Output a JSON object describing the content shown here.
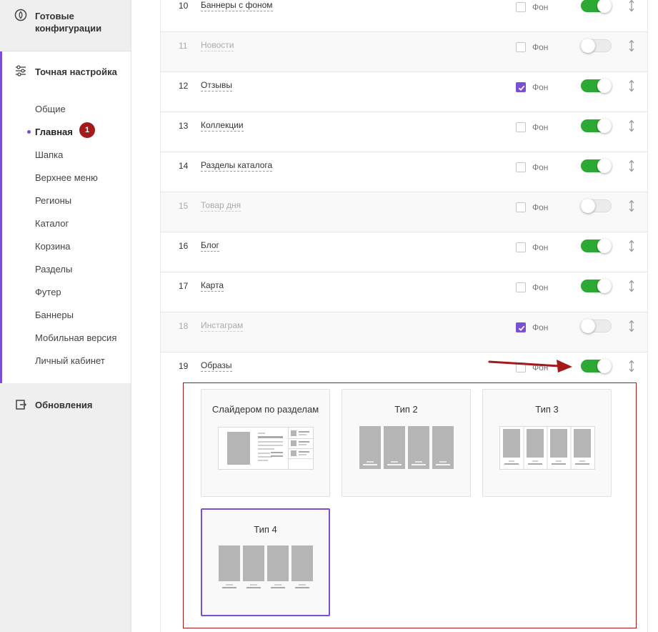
{
  "sidebar": {
    "ready_configs": {
      "label": "Готовые конфигурации",
      "icon": "compass-icon"
    },
    "fine_tune": {
      "label": "Точная настройка",
      "icon": "sliders-icon",
      "items": [
        {
          "label": "Общие"
        },
        {
          "label": "Главная",
          "active": true,
          "badge": "1"
        },
        {
          "label": "Шапка"
        },
        {
          "label": "Верхнее меню"
        },
        {
          "label": "Регионы"
        },
        {
          "label": "Каталог"
        },
        {
          "label": "Корзина"
        },
        {
          "label": "Разделы"
        },
        {
          "label": "Футер"
        },
        {
          "label": "Баннеры"
        },
        {
          "label": "Мобильная версия"
        },
        {
          "label": "Личный кабинет"
        }
      ]
    },
    "updates": {
      "label": "Обновления",
      "icon": "refresh-icon"
    }
  },
  "rows": [
    {
      "num": "10",
      "name": "Баннеры с фоном",
      "bg_checked": false,
      "enabled": true
    },
    {
      "num": "11",
      "name": "Новости",
      "bg_checked": false,
      "enabled": false
    },
    {
      "num": "12",
      "name": "Отзывы",
      "bg_checked": true,
      "enabled": true
    },
    {
      "num": "13",
      "name": "Коллекции",
      "bg_checked": false,
      "enabled": true
    },
    {
      "num": "14",
      "name": "Разделы каталога",
      "bg_checked": false,
      "enabled": true
    },
    {
      "num": "15",
      "name": "Товар дня",
      "bg_checked": false,
      "enabled": false
    },
    {
      "num": "16",
      "name": "Блог",
      "bg_checked": false,
      "enabled": true
    },
    {
      "num": "17",
      "name": "Карта",
      "bg_checked": false,
      "enabled": true
    },
    {
      "num": "18",
      "name": "Инстаграм",
      "bg_checked": true,
      "enabled": false
    },
    {
      "num": "19",
      "name": "Образы",
      "bg_checked": false,
      "enabled": true
    }
  ],
  "bg_label": "Фон",
  "types": [
    {
      "title": "Слайдером по разделам",
      "selected": false
    },
    {
      "title": "Тип 2",
      "selected": false
    },
    {
      "title": "Тип 3",
      "selected": false
    },
    {
      "title": "Тип 4",
      "selected": true
    }
  ],
  "colors": {
    "accent": "#7a4fd6",
    "toggle_on": "#2aaa33",
    "highlight": "#a41a1a"
  }
}
